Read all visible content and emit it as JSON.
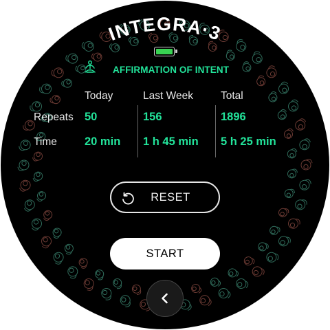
{
  "header": {
    "brand": "INTEGRA·3",
    "battery_level": 1.0,
    "battery_color": "#39d353",
    "mode_icon": "meditation-icon",
    "mode_title": "AFFIRMATION OF INTENT"
  },
  "stats": {
    "columns": [
      "Today",
      "Last Week",
      "Total"
    ],
    "rows": [
      {
        "label": "Repeats",
        "values": [
          "50",
          "156",
          "1896"
        ]
      },
      {
        "label": "Time",
        "values": [
          "20 min",
          "1 h 45 min",
          "5 h 25 min"
        ]
      }
    ]
  },
  "buttons": {
    "reset_icon": "reset-icon",
    "reset_label": "RESET",
    "start_label": "START",
    "back_icon": "chevron-left-icon"
  },
  "colors": {
    "accent": "#22e39a",
    "background": "#000000",
    "ornament_green": "#2f6b5a",
    "ornament_red": "#6b3a33"
  }
}
